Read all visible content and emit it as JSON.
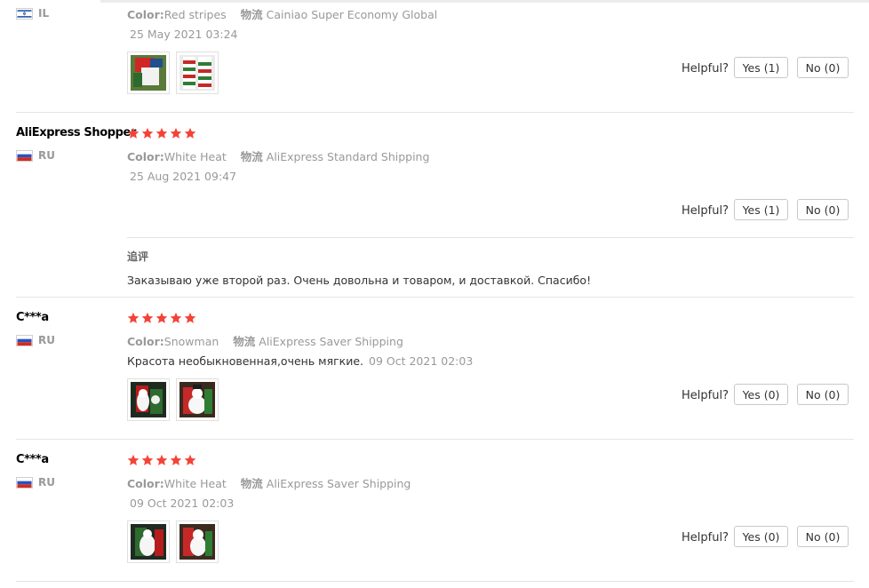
{
  "colors": {
    "star": "#f44336",
    "muted": "#999999",
    "border": "#c8c8c8"
  },
  "common": {
    "helpful_label": "Helpful?",
    "color_label": "Color:",
    "shipping_label": "物流"
  },
  "reviews": [
    {
      "name": "",
      "country": "IL",
      "flag": "israel-flag-icon",
      "stars": 5,
      "color": "Red stripes",
      "shipping": "Cainiao Super Economy Global",
      "date": "25 May 2021 03:24",
      "images": [
        "stocking-photo-1",
        "stocking-photo-2"
      ],
      "yes": "Yes (1)",
      "no": "No (0)"
    },
    {
      "name": "AliExpress Shopper",
      "country": "RU",
      "flag": "russia-flag-icon",
      "stars": 5,
      "color": "White Heat",
      "shipping": "AliExpress Standard Shipping",
      "date": "25 Aug 2021 09:47",
      "yes": "Yes (1)",
      "no": "No (0)",
      "additional_label": "追评",
      "additional_text": "Заказываю уже второй раз. Очень довольна и товаром, и доставкой. Спасибо!"
    },
    {
      "name": "C***a",
      "country": "RU",
      "flag": "russia-flag-icon",
      "stars": 5,
      "color": "Snowman",
      "shipping": "AliExpress Saver Shipping",
      "feedback": "Красота необыкновенная,очень мягкие.",
      "date": "09 Oct 2021 02:03",
      "images": [
        "snowman-stocking-photo-1",
        "snowman-stocking-photo-2"
      ],
      "yes": "Yes (0)",
      "no": "No (0)"
    },
    {
      "name": "C***a",
      "country": "RU",
      "flag": "russia-flag-icon",
      "stars": 5,
      "color": "White Heat",
      "shipping": "AliExpress Saver Shipping",
      "date": "09 Oct 2021 02:03",
      "images": [
        "white-stocking-photo-1",
        "white-stocking-photo-2"
      ],
      "yes": "Yes (0)",
      "no": "No (0)"
    }
  ]
}
